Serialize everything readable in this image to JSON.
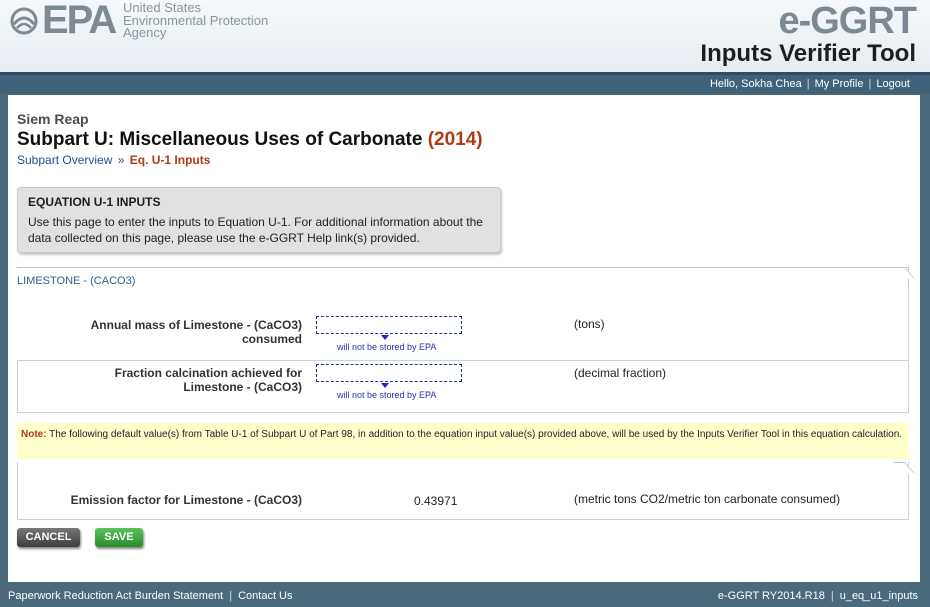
{
  "header": {
    "logo_text": "EPA",
    "agency_line1": "United States",
    "agency_line2": "Environmental Protection",
    "agency_line3": "Agency",
    "app_name": "e-GGRT",
    "tool_name": "Inputs Verifier Tool"
  },
  "topnav": {
    "greeting": "Hello, Sokha Chea",
    "profile": "My Profile",
    "logout": "Logout"
  },
  "page": {
    "facility": "Siem Reap",
    "title": "Subpart U: Miscellaneous Uses of Carbonate",
    "year": "(2014)",
    "breadcrumb": {
      "overview": "Subpart Overview",
      "sep": "»",
      "current": "Eq. U-1 Inputs"
    }
  },
  "info_box": {
    "title": "EQUATION U-1 INPUTS",
    "text": "Use this page to enter the inputs to Equation U-1. For additional information about the data collected on this page, please use the e-GGRT Help link(s) provided."
  },
  "section": {
    "legend": "LIMESTONE - (CACO3)",
    "fields": [
      {
        "label": "Annual mass of Limestone - (CaCO3) consumed",
        "value": "",
        "note": "will not be stored by EPA",
        "units": "(tons)"
      },
      {
        "label_line1": "Fraction calcination achieved for",
        "label_line2": "Limestone - (CaCO3)",
        "value": "",
        "note": "will not be stored by EPA",
        "units": "(decimal fraction)"
      }
    ]
  },
  "note": {
    "label": "Note:",
    "text": " The following default value(s) from Table U-1 of Subpart U of Part 98, in addition to the equation input value(s) provided above, will be used by the Inputs Verifier Tool in this equation calculation."
  },
  "default_value": {
    "label": "Emission factor for Limestone - (CaCO3)",
    "value": "0.43971",
    "units": "(metric tons CO2/metric ton carbonate consumed)"
  },
  "buttons": {
    "cancel": "CANCEL",
    "save": "SAVE"
  },
  "footer": {
    "paperwork": "Paperwork Reduction Act Burden Statement",
    "contact": "Contact Us",
    "version": "e-GGRT RY2014.R18",
    "page_id": "u_eq_u1_inputs"
  },
  "colors": {
    "nav_bg": "#3f6479",
    "accent_red": "#b03a16",
    "link_blue": "#20519a",
    "save_green": "#2a8a2a"
  }
}
